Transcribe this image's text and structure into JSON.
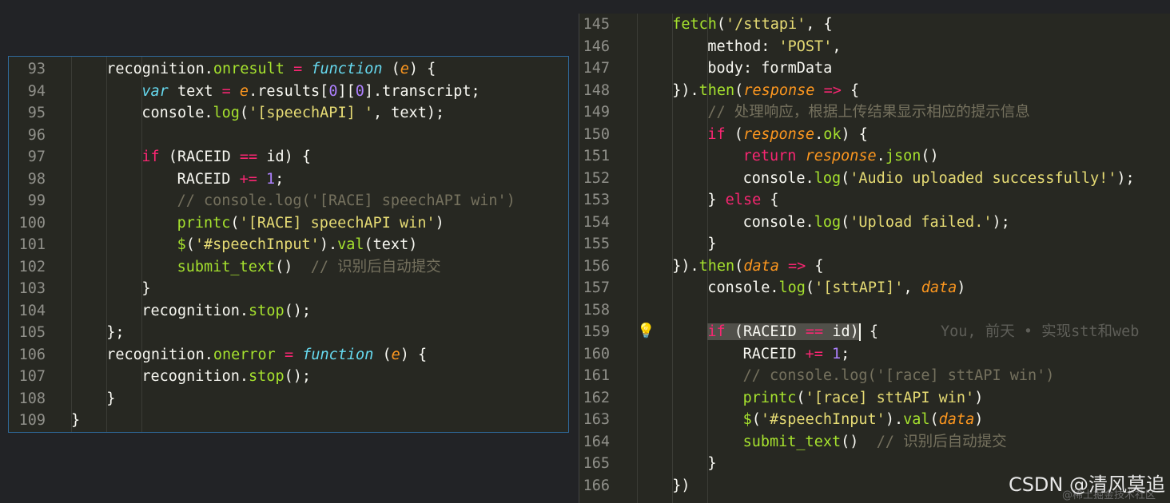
{
  "left_editor": {
    "lines": [
      {
        "num": "93",
        "tokens": [
          [
            "plain",
            "recognition."
          ],
          [
            "fn",
            "onresult"
          ],
          [
            "op",
            " = "
          ],
          [
            "stor",
            "function"
          ],
          [
            "plain",
            " ("
          ],
          [
            "param",
            "e"
          ],
          [
            "plain",
            ") {"
          ]
        ]
      },
      {
        "num": "94",
        "tokens": [
          [
            "stor",
            "var"
          ],
          [
            "plain",
            " text "
          ],
          [
            "op",
            "="
          ],
          [
            "plain",
            " "
          ],
          [
            "param",
            "e"
          ],
          [
            "plain",
            ".results["
          ],
          [
            "num",
            "0"
          ],
          [
            "plain",
            "]["
          ],
          [
            "num",
            "0"
          ],
          [
            "plain",
            "].transcript;"
          ]
        ]
      },
      {
        "num": "95",
        "tokens": [
          [
            "plain",
            "console."
          ],
          [
            "fn",
            "log"
          ],
          [
            "plain",
            "("
          ],
          [
            "str",
            "'[speechAPI] '"
          ],
          [
            "plain",
            ", text);"
          ]
        ]
      },
      {
        "num": "96",
        "tokens": []
      },
      {
        "num": "97",
        "tokens": [
          [
            "kw",
            "if"
          ],
          [
            "plain",
            " (RACEID "
          ],
          [
            "op",
            "=="
          ],
          [
            "plain",
            " id) {"
          ]
        ]
      },
      {
        "num": "98",
        "tokens": [
          [
            "plain",
            "RACEID "
          ],
          [
            "op",
            "+="
          ],
          [
            "plain",
            " "
          ],
          [
            "num",
            "1"
          ],
          [
            "plain",
            ";"
          ]
        ]
      },
      {
        "num": "99",
        "tokens": [
          [
            "cmt",
            "// console.log('[RACE] speechAPI win')"
          ]
        ]
      },
      {
        "num": "100",
        "tokens": [
          [
            "fn",
            "printc"
          ],
          [
            "plain",
            "("
          ],
          [
            "str",
            "'[RACE] speechAPI win'"
          ],
          [
            "plain",
            ")"
          ]
        ]
      },
      {
        "num": "101",
        "tokens": [
          [
            "fn",
            "$"
          ],
          [
            "plain",
            "("
          ],
          [
            "str",
            "'#speechInput'"
          ],
          [
            "plain",
            ")."
          ],
          [
            "fn",
            "val"
          ],
          [
            "plain",
            "(text)"
          ]
        ]
      },
      {
        "num": "102",
        "tokens": [
          [
            "fn",
            "submit_text"
          ],
          [
            "plain",
            "()  "
          ],
          [
            "cmt",
            "// 识别后自动提交"
          ]
        ]
      },
      {
        "num": "103",
        "tokens": [
          [
            "plain",
            "}"
          ]
        ]
      },
      {
        "num": "104",
        "tokens": [
          [
            "plain",
            "recognition."
          ],
          [
            "fn",
            "stop"
          ],
          [
            "plain",
            "();"
          ]
        ]
      },
      {
        "num": "105",
        "tokens": [
          [
            "plain",
            "};"
          ]
        ]
      },
      {
        "num": "106",
        "tokens": [
          [
            "plain",
            "recognition."
          ],
          [
            "fn",
            "onerror"
          ],
          [
            "op",
            " = "
          ],
          [
            "stor",
            "function"
          ],
          [
            "plain",
            " ("
          ],
          [
            "param",
            "e"
          ],
          [
            "plain",
            ") {"
          ]
        ]
      },
      {
        "num": "107",
        "tokens": [
          [
            "plain",
            "recognition."
          ],
          [
            "fn",
            "stop"
          ],
          [
            "plain",
            "();"
          ]
        ]
      },
      {
        "num": "108",
        "tokens": [
          [
            "plain",
            "}"
          ]
        ]
      },
      {
        "num": "109",
        "tokens": [
          [
            "plain",
            "}"
          ]
        ]
      }
    ]
  },
  "right_editor": {
    "lines": [
      {
        "num": "145",
        "tokens": [
          [
            "fn",
            "fetch"
          ],
          [
            "plain",
            "("
          ],
          [
            "str",
            "'/sttapi'"
          ],
          [
            "plain",
            ", {"
          ]
        ]
      },
      {
        "num": "146",
        "tokens": [
          [
            "plain",
            "method: "
          ],
          [
            "str",
            "'POST'"
          ],
          [
            "plain",
            ","
          ]
        ]
      },
      {
        "num": "147",
        "tokens": [
          [
            "plain",
            "body: formData"
          ]
        ]
      },
      {
        "num": "148",
        "tokens": [
          [
            "plain",
            "})."
          ],
          [
            "fn",
            "then"
          ],
          [
            "plain",
            "("
          ],
          [
            "param",
            "response"
          ],
          [
            "plain",
            " "
          ],
          [
            "op",
            "=>"
          ],
          [
            "plain",
            " {"
          ]
        ]
      },
      {
        "num": "149",
        "tokens": [
          [
            "cmt",
            "// 处理响应，根据上传结果显示相应的提示信息"
          ]
        ]
      },
      {
        "num": "150",
        "tokens": [
          [
            "kw",
            "if"
          ],
          [
            "plain",
            " ("
          ],
          [
            "param",
            "response"
          ],
          [
            "plain",
            "."
          ],
          [
            "fn",
            "ok"
          ],
          [
            "plain",
            ") {"
          ]
        ]
      },
      {
        "num": "151",
        "tokens": [
          [
            "kw",
            "return"
          ],
          [
            "plain",
            " "
          ],
          [
            "param",
            "response"
          ],
          [
            "plain",
            "."
          ],
          [
            "fn",
            "json"
          ],
          [
            "plain",
            "()"
          ]
        ]
      },
      {
        "num": "152",
        "tokens": [
          [
            "plain",
            "console."
          ],
          [
            "fn",
            "log"
          ],
          [
            "plain",
            "("
          ],
          [
            "str",
            "'Audio uploaded successfully!'"
          ],
          [
            "plain",
            ");"
          ]
        ]
      },
      {
        "num": "153",
        "tokens": [
          [
            "plain",
            "} "
          ],
          [
            "kw",
            "else"
          ],
          [
            "plain",
            " {"
          ]
        ]
      },
      {
        "num": "154",
        "tokens": [
          [
            "plain",
            "console."
          ],
          [
            "fn",
            "log"
          ],
          [
            "plain",
            "("
          ],
          [
            "str",
            "'Upload failed.'"
          ],
          [
            "plain",
            ");"
          ]
        ]
      },
      {
        "num": "155",
        "tokens": [
          [
            "plain",
            "}"
          ]
        ]
      },
      {
        "num": "156",
        "tokens": [
          [
            "plain",
            "})."
          ],
          [
            "fn",
            "then"
          ],
          [
            "plain",
            "("
          ],
          [
            "param",
            "data"
          ],
          [
            "plain",
            " "
          ],
          [
            "op",
            "=>"
          ],
          [
            "plain",
            " {"
          ]
        ]
      },
      {
        "num": "157",
        "tokens": [
          [
            "plain",
            "console."
          ],
          [
            "fn",
            "log"
          ],
          [
            "plain",
            "("
          ],
          [
            "str",
            "'[sttAPI]'"
          ],
          [
            "plain",
            ", "
          ],
          [
            "param",
            "data"
          ],
          [
            "plain",
            ")"
          ]
        ]
      },
      {
        "num": "158",
        "tokens": []
      },
      {
        "num": "159",
        "tokens": [
          [
            "kw hl",
            "if"
          ],
          [
            "plain hl",
            " (RACEID "
          ],
          [
            "op hl",
            "=="
          ],
          [
            "plain hl",
            " id)"
          ],
          [
            "cursor",
            ""
          ],
          [
            "plain",
            " {"
          ],
          [
            "blame",
            "       You, 前天 • 实现stt和web"
          ]
        ]
      },
      {
        "num": "160",
        "tokens": [
          [
            "plain",
            "RACEID "
          ],
          [
            "op",
            "+="
          ],
          [
            "plain",
            " "
          ],
          [
            "num",
            "1"
          ],
          [
            "plain",
            ";"
          ]
        ]
      },
      {
        "num": "161",
        "tokens": [
          [
            "cmt",
            "// console.log('[race] sttAPI win')"
          ]
        ]
      },
      {
        "num": "162",
        "tokens": [
          [
            "fn",
            "printc"
          ],
          [
            "plain",
            "("
          ],
          [
            "str",
            "'[race] sttAPI win'"
          ],
          [
            "plain",
            ")"
          ]
        ]
      },
      {
        "num": "163",
        "tokens": [
          [
            "fn",
            "$"
          ],
          [
            "plain",
            "("
          ],
          [
            "str",
            "'#speechInput'"
          ],
          [
            "plain",
            ")."
          ],
          [
            "fn",
            "val"
          ],
          [
            "plain",
            "("
          ],
          [
            "param",
            "data"
          ],
          [
            "plain",
            ")"
          ]
        ]
      },
      {
        "num": "164",
        "tokens": [
          [
            "fn",
            "submit_text"
          ],
          [
            "plain",
            "()  "
          ],
          [
            "cmt",
            "// 识别后自动提交"
          ]
        ]
      },
      {
        "num": "165",
        "tokens": [
          [
            "plain",
            "}"
          ]
        ]
      },
      {
        "num": "166",
        "tokens": [
          [
            "plain",
            "})"
          ]
        ]
      }
    ]
  },
  "lightbulb_icon": "lightbulb-icon",
  "watermark": "CSDN @清风莫追",
  "watermark_under": "@稀土掘金技术社区"
}
